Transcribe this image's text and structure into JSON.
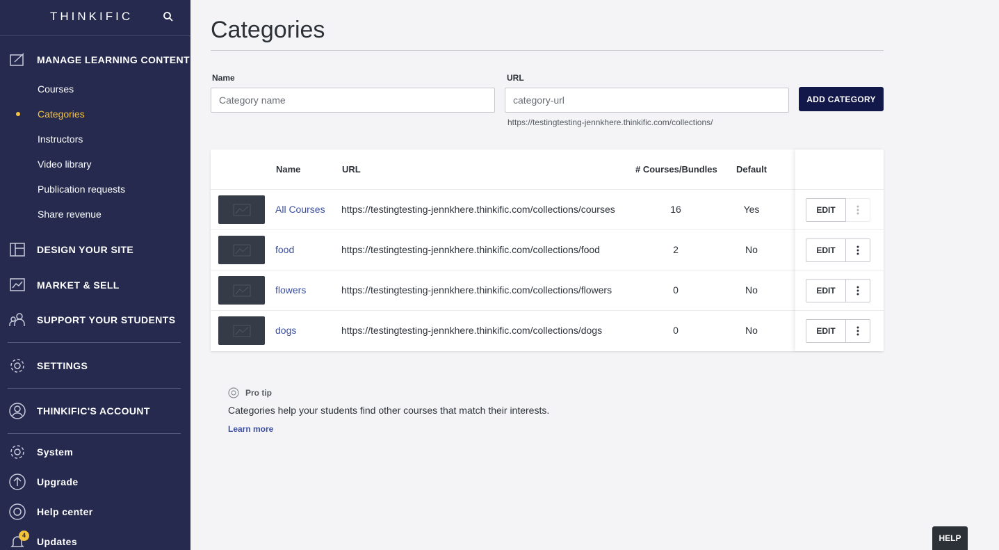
{
  "sidebar": {
    "logo": "THINKIFIC",
    "sections": {
      "manage": "MANAGE LEARNING CONTENT",
      "design": "DESIGN YOUR SITE",
      "market": "MARKET & SELL",
      "support": "SUPPORT YOUR STUDENTS",
      "settings": "SETTINGS",
      "account": "THINKIFIC'S ACCOUNT"
    },
    "sub_items": {
      "courses": "Courses",
      "categories": "Categories",
      "instructors": "Instructors",
      "video_library": "Video library",
      "publication_requests": "Publication requests",
      "share_revenue": "Share revenue"
    },
    "footer": {
      "system": "System",
      "upgrade": "Upgrade",
      "help_center": "Help center",
      "updates": "Updates",
      "updates_badge": "4"
    },
    "colors": {
      "background": "#262a4f",
      "active": "#f5c33b"
    }
  },
  "main": {
    "title": "Categories",
    "form": {
      "name_label": "Name",
      "name_placeholder": "Category name",
      "url_label": "URL",
      "url_placeholder": "category-url",
      "url_hint": "https://testingtesting-jennkhere.thinkific.com/collections/",
      "add_button": "ADD CATEGORY"
    },
    "table": {
      "headers": {
        "name": "Name",
        "url": "URL",
        "count": "# Courses/Bundles",
        "default": "Default"
      },
      "rows": [
        {
          "name": "All Courses",
          "url": "https://testingtesting-jennkhere.thinkific.com/collections/courses",
          "count": "16",
          "default": "Yes"
        },
        {
          "name": "food",
          "url": "https://testingtesting-jennkhere.thinkific.com/collections/food",
          "count": "2",
          "default": "No"
        },
        {
          "name": "flowers",
          "url": "https://testingtesting-jennkhere.thinkific.com/collections/flowers",
          "count": "0",
          "default": "No"
        },
        {
          "name": "dogs",
          "url": "https://testingtesting-jennkhere.thinkific.com/collections/dogs",
          "count": "0",
          "default": "No"
        }
      ],
      "edit_label": "EDIT"
    },
    "protip": {
      "label": "Pro tip",
      "text": "Categories help your students find other courses that match their interests.",
      "link": "Learn more"
    },
    "help_button": "HELP",
    "colors": {
      "primary_button": "#13184a",
      "link": "#3b4fa1"
    }
  }
}
